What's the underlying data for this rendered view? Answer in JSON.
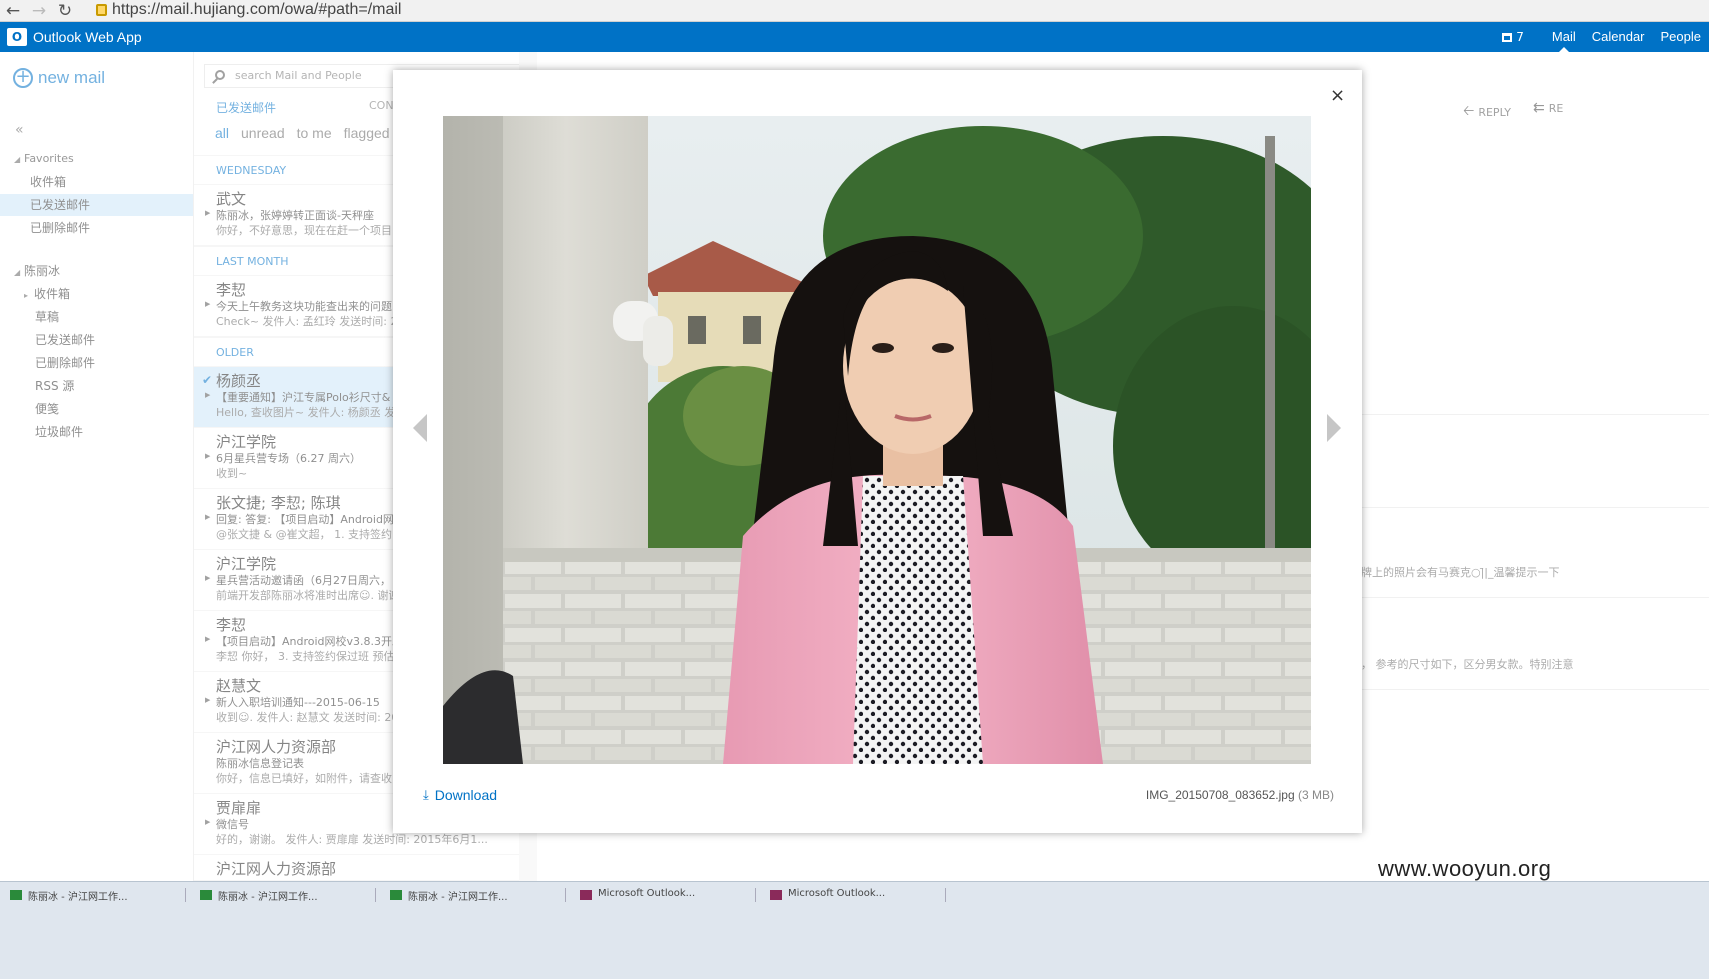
{
  "browser": {
    "url": "https://mail.hujiang.com/owa/#path=/mail"
  },
  "header": {
    "app_name": "Outlook Web App",
    "notification_count": "7",
    "nav": [
      "Mail",
      "Calendar",
      "People"
    ],
    "active_nav": "Mail"
  },
  "folders": {
    "new_mail": "new mail",
    "collapse": "«",
    "favorites_label": "Favorites",
    "favorites": [
      "收件箱",
      "已发送邮件",
      "已删除邮件"
    ],
    "selected": "已发送邮件",
    "account": "陈丽冰",
    "account_folders": [
      "收件箱",
      "草稿",
      "已发送邮件",
      "已删除邮件",
      "RSS 源",
      "便笺",
      "垃圾邮件"
    ]
  },
  "list": {
    "search_placeholder": "search Mail and People",
    "folder_title": "已发送邮件",
    "conversations_label": "CON",
    "filters": [
      "all",
      "unread",
      "to me",
      "flagged"
    ],
    "groups": [
      "WEDNESDAY",
      "LAST MONTH",
      "OLDER"
    ],
    "messages": [
      {
        "from": "武文",
        "subject": "陈丽冰，张婷婷转正面谈-天秤座",
        "preview": "你好，不好意思，现在在赶一个项目"
      },
      {
        "from": "李恝",
        "subject": "今天上午教务这块功能查出来的问题",
        "preview": "Check~ 发件人: 孟红玲 发送时间: 20"
      },
      {
        "from": "杨颜丞",
        "subject": "【重要通知】沪江专属Polo衫尺寸&",
        "preview": "Hello, 查收图片~ 发件人: 杨颜丞 发送"
      },
      {
        "from": "沪江学院",
        "subject": "6月星兵营专场（6.27 周六）",
        "preview": "收到~"
      },
      {
        "from": "张文捷; 李恝; 陈琪",
        "subject": "回复: 答复: 【项目启动】Android网",
        "preview": "@张文捷 & @崔文超，  1. 支持签约"
      },
      {
        "from": "沪江学院",
        "subject": "星兵营活动邀请函（6月27日周六，",
        "preview": "前端开发部陈丽冰将准时出席☺. 谢谢"
      },
      {
        "from": "李恝",
        "subject": "【项目启动】Android网校v3.8.3开发",
        "preview": "李恝 你好，  3. 支持签约保过班 预估"
      },
      {
        "from": "赵慧文",
        "subject": "新人入职培训通知---2015-06-15",
        "preview": "收到☺. 发件人: 赵慧文 发送时间: 20"
      },
      {
        "from": "沪江网人力资源部",
        "subject": "陈丽冰信息登记表",
        "preview": "你好，信息已填好，如附件，请查收"
      },
      {
        "from": "贾扉扉",
        "subject": "微信号",
        "preview": "好的，谢谢。  发件人: 贾扉扉 发送时间: 2015年6月1..."
      },
      {
        "from": "沪江网人力资源部",
        "subject": "",
        "preview": ""
      }
    ]
  },
  "reading": {
    "reply": "REPLY",
    "reply_all": "RE",
    "snippet_1": "牌上的照片会有马赛克○|̄|_温馨提示一下",
    "snippet_2": "， 参考的尺寸如下，区分男女款。特别注意"
  },
  "viewer": {
    "close": "×",
    "download": "Download",
    "filename": "IMG_20150708_083652.jpg",
    "filesize": "(3 MB)"
  },
  "taskbar": {
    "items": [
      "陈丽冰 - 沪江网工作...",
      "陈丽冰 - 沪江网工作...",
      "陈丽冰 - 沪江网工作...",
      "Microsoft Outlook...",
      "Microsoft Outlook..."
    ]
  },
  "watermark": "www.wooyun.org",
  "colors": {
    "brand": "#0072c6",
    "selected_bg": "#cde6f7"
  }
}
